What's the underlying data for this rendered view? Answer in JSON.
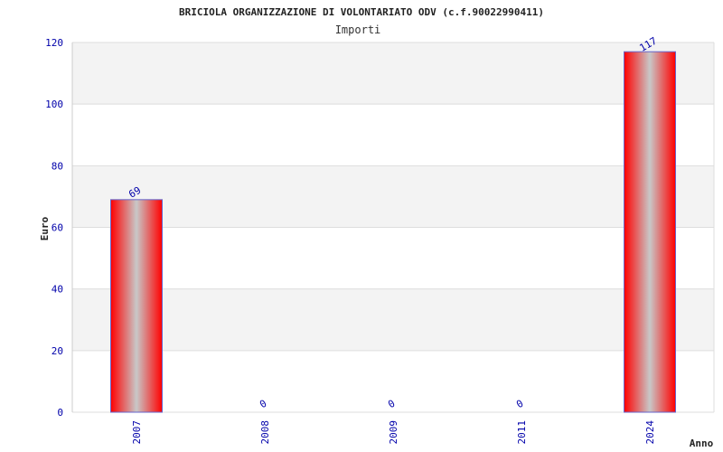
{
  "chart_data": {
    "type": "bar",
    "title": "BRICIOLA ORGANIZZAZIONE DI VOLONTARIATO ODV (c.f.90022990411)",
    "subtitle": "Importi",
    "xlabel": "Anno",
    "ylabel": "Euro",
    "categories": [
      "2007",
      "2008",
      "2009",
      "2011",
      "2024"
    ],
    "values": [
      69,
      0,
      0,
      0,
      117
    ],
    "value_labels": [
      "69",
      "0",
      "0",
      "0",
      "117"
    ],
    "ylim": [
      0,
      120
    ],
    "yticks": [
      "0",
      "20",
      "40",
      "60",
      "80",
      "100",
      "120"
    ],
    "grid": true,
    "legend": "none",
    "colors": {
      "bar_edge": "#ff0000",
      "bar_center": "#c8c8c8",
      "bar_border": "#6666cc",
      "band": "#f3f3f3",
      "tick_text": "#0000aa"
    }
  }
}
